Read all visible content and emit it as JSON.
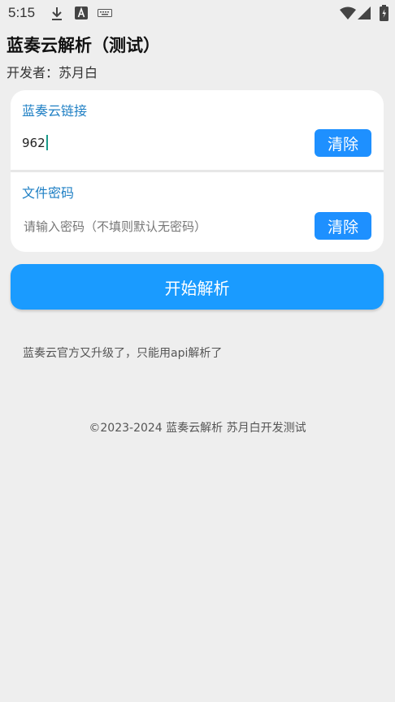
{
  "status_bar": {
    "time": "5:15",
    "icons": [
      "download-icon",
      "font-a-icon",
      "keyboard-icon",
      "wifi-icon",
      "signal-icon",
      "battery-icon"
    ]
  },
  "header": {
    "title": "蓝奏云解析（测试）",
    "developer": "开发者：苏月白"
  },
  "form": {
    "link_section": {
      "label": "蓝奏云链接",
      "value": "962",
      "clear_label": "清除"
    },
    "password_section": {
      "label": "文件密码",
      "placeholder": "请输入密码（不填则默认无密码）",
      "clear_label": "清除"
    }
  },
  "start_button": "开始解析",
  "notice": "蓝奏云官方又升级了，只能用api解析了",
  "footer": "©2023-2024 蓝奏云解析 苏月白开发测试",
  "colors": {
    "accent": "#1a9bff",
    "label": "#1e7fc4",
    "background": "#eeeeee"
  }
}
